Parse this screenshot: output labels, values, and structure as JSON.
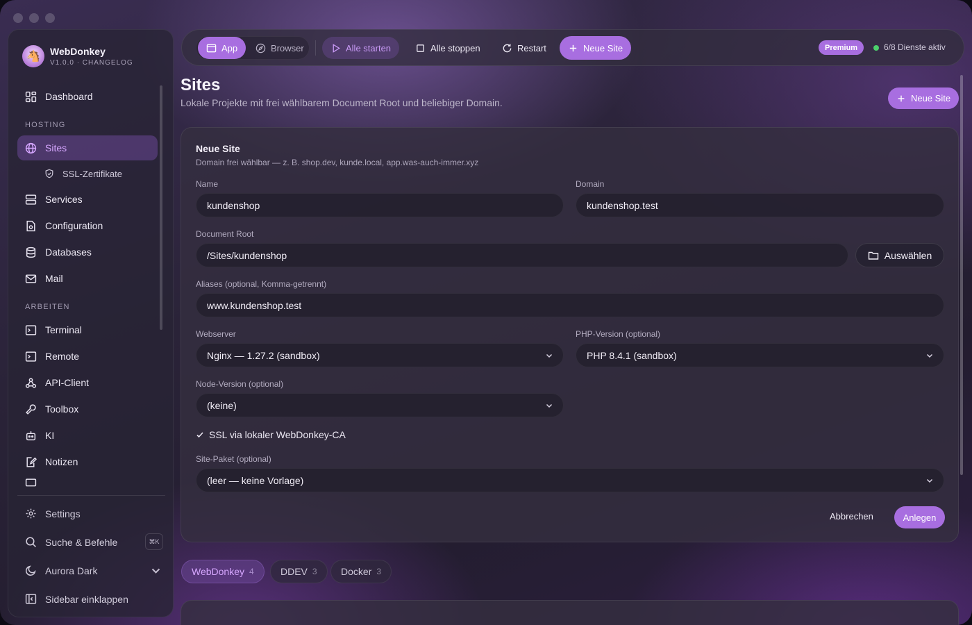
{
  "app": {
    "name": "WebDonkey",
    "version_line": "V1.0.0 · CHANGELOG"
  },
  "sidebar": {
    "dashboard": "Dashboard",
    "section_hosting": "HOSTING",
    "sites": "Sites",
    "ssl": "SSL-Zertifikate",
    "services": "Services",
    "configuration": "Configuration",
    "databases": "Databases",
    "mail": "Mail",
    "section_arbeiten": "ARBEITEN",
    "terminal": "Terminal",
    "remote": "Remote",
    "api_client": "API-Client",
    "toolbox": "Toolbox",
    "ki": "KI",
    "notizen": "Notizen",
    "settings": "Settings",
    "search": "Suche & Befehle",
    "search_kbd": "⌘K",
    "theme": "Aurora Dark",
    "collapse": "Sidebar einklappen"
  },
  "toolbar": {
    "app": "App",
    "browser": "Browser",
    "start_all": "Alle starten",
    "stop_all": "Alle stoppen",
    "restart": "Restart",
    "new_site": "Neue Site",
    "premium": "Premium",
    "status": "6/8 Dienste aktiv"
  },
  "page": {
    "title": "Sites",
    "subtitle": "Lokale Projekte mit frei wählbarem Document Root und beliebiger Domain.",
    "new_site_button": "Neue Site"
  },
  "form": {
    "title": "Neue Site",
    "subtitle": "Domain frei wählbar — z. B. shop.dev, kunde.local, app.was-auch-immer.xyz",
    "name_label": "Name",
    "name_value": "kundenshop",
    "domain_label": "Domain",
    "domain_value": "kundenshop.test",
    "docroot_label": "Document Root",
    "docroot_value": "/Sites/kundenshop",
    "choose_button": "Auswählen",
    "aliases_label": "Aliases (optional, Komma-getrennt)",
    "aliases_value": "www.kundenshop.test",
    "webserver_label": "Webserver",
    "webserver_value": "Nginx — 1.27.2 (sandbox)",
    "php_label": "PHP-Version (optional)",
    "php_value": "PHP 8.4.1 (sandbox)",
    "node_label": "Node-Version (optional)",
    "node_value": "(keine)",
    "ssl_label": "SSL via lokaler WebDonkey-CA",
    "ssl_checked": true,
    "package_label": "Site-Paket (optional)",
    "package_value": "(leer — keine Vorlage)",
    "cancel": "Abbrechen",
    "create": "Anlegen"
  },
  "tabs": [
    {
      "label": "WebDonkey",
      "count": "4"
    },
    {
      "label": "DDEV",
      "count": "3"
    },
    {
      "label": "Docker",
      "count": "3"
    }
  ],
  "colors": {
    "accent": "#a86ee0",
    "accent_text": "#d6a6ff",
    "status_ok": "#4cd06c"
  }
}
